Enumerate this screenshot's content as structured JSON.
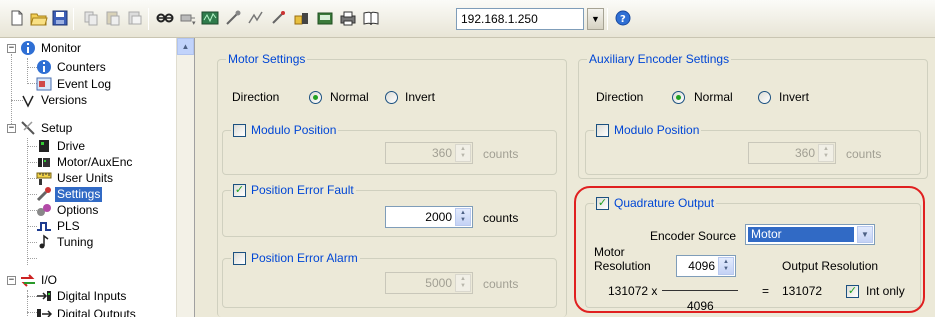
{
  "toolbar": {
    "ip_address": "192.168.1.250",
    "icons": [
      "new-icon",
      "open-icon",
      "save-icon",
      "copy-icon",
      "paste-icon",
      "connect-icon",
      "disconnect-icon",
      "scope-icon",
      "tune-icon",
      "motion-icon",
      "probe-icon",
      "download-icon",
      "upload-icon",
      "print-icon",
      "manual-icon",
      "help-icon"
    ]
  },
  "tree": {
    "items": [
      {
        "label": "Monitor",
        "icon": "info-icon"
      },
      {
        "label": "Counters",
        "icon": "info-icon"
      },
      {
        "label": "Event Log",
        "icon": "event-log-icon"
      },
      {
        "label": "Versions",
        "icon": "check-icon"
      },
      {
        "label": "Setup",
        "icon": "setup-icon"
      },
      {
        "label": "Drive",
        "icon": "drive-icon"
      },
      {
        "label": "Motor/AuxEnc",
        "icon": "motor-icon"
      },
      {
        "label": "User Units",
        "icon": "ruler-icon"
      },
      {
        "label": "Settings",
        "icon": "wrench-icon"
      },
      {
        "label": "Options",
        "icon": "options-icon"
      },
      {
        "label": "PLS",
        "icon": "pulse-icon"
      },
      {
        "label": "Tuning",
        "icon": "note-icon"
      },
      {
        "label": "I/O",
        "icon": "io-icon"
      },
      {
        "label": "Digital Inputs",
        "icon": "digital-input-icon"
      },
      {
        "label": "Digital Outputs",
        "icon": "digital-output-icon"
      }
    ],
    "selected": "Settings"
  },
  "motor_settings": {
    "title": "Motor Settings",
    "direction_label": "Direction",
    "normal_label": "Normal",
    "invert_label": "Invert",
    "direction_value": "Normal",
    "modulo": {
      "label": "Modulo Position",
      "checked": false,
      "value": "360",
      "unit": "counts"
    },
    "pos_error_fault": {
      "label": "Position Error Fault",
      "checked": true,
      "value": "2000",
      "unit": "counts"
    },
    "pos_error_alarm": {
      "label": "Position Error Alarm",
      "checked": false,
      "value": "5000",
      "unit": "counts"
    }
  },
  "aux_encoder_settings": {
    "title": "Auxiliary Encoder Settings",
    "direction_label": "Direction",
    "normal_label": "Normal",
    "invert_label": "Invert",
    "direction_value": "Normal",
    "modulo": {
      "label": "Modulo Position",
      "checked": false,
      "value": "360",
      "unit": "counts"
    }
  },
  "quadrature_output": {
    "label": "Quadrature Output",
    "checked": true,
    "encoder_source_label": "Encoder Source",
    "encoder_source_value": "Motor",
    "motor_resolution_label_1": "Motor",
    "motor_resolution_label_2": "Resolution",
    "motor_resolution_value": "4096",
    "numerator": "131072 x",
    "denominator": "4096",
    "equals": "=",
    "output_resolution_label": "Output Resolution",
    "output_resolution_value": "131072",
    "int_only_label": "Int only",
    "int_only_checked": true
  },
  "colors": {
    "group_title": "#0046d5",
    "selection": "#316ac5",
    "highlight_ring": "#e02020"
  }
}
